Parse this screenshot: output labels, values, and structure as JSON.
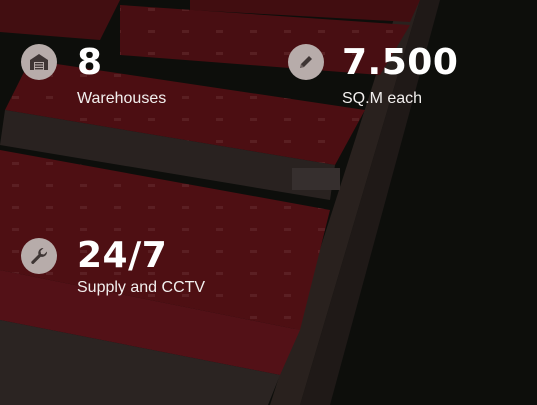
{
  "stats": [
    {
      "value": "8",
      "label": "Warehouses",
      "icon": "warehouse-icon"
    },
    {
      "value": "7.500",
      "label": "SQ.M each",
      "icon": "ruler-pencil-icon"
    },
    {
      "value": "24/7",
      "label": "Supply and CCTV",
      "icon": "wrench-icon"
    }
  ],
  "colors": {
    "icon_bg": "#b7acaa",
    "icon_fg": "#3e3534",
    "text": "#ffffff",
    "roof": "#6a1218"
  }
}
